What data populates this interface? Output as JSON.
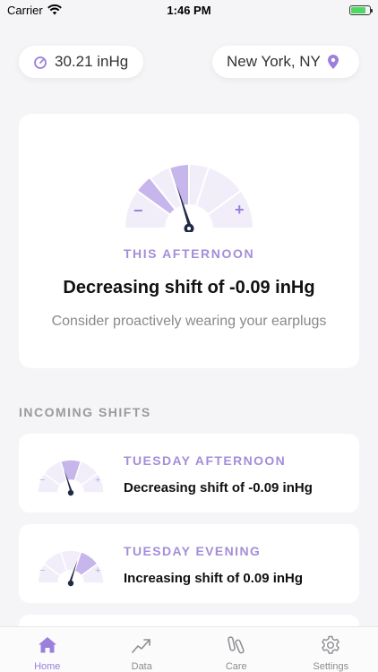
{
  "status_bar": {
    "carrier": "Carrier",
    "time": "1:46 PM"
  },
  "header": {
    "pressure": "30.21 inHg",
    "location": "New York, NY"
  },
  "current": {
    "when": "THIS AFTERNOON",
    "shift": "Decreasing shift of -0.09 inHg",
    "advice": "Consider proactively wearing your earplugs",
    "gauge_minus": "−",
    "gauge_plus": "+"
  },
  "incoming": {
    "title": "INCOMING SHIFTS",
    "items": [
      {
        "when": "TUESDAY AFTERNOON",
        "shift": "Decreasing shift of -0.09 inHg",
        "direction": "decrease"
      },
      {
        "when": "TUESDAY EVENING",
        "shift": "Increasing shift of 0.09 inHg",
        "direction": "increase"
      }
    ]
  },
  "tabs": [
    {
      "label": "Home",
      "icon": "home-icon",
      "active": true
    },
    {
      "label": "Data",
      "icon": "trend-icon",
      "active": false
    },
    {
      "label": "Care",
      "icon": "earplugs-icon",
      "active": false
    },
    {
      "label": "Settings",
      "icon": "gear-icon",
      "active": false
    }
  ],
  "colors": {
    "accent": "#a48ed8",
    "gauge_highlight": "#c7b6eb",
    "gauge_base": "#f1eefa",
    "needle": "#1f2a44",
    "background": "#f5f5f7"
  }
}
